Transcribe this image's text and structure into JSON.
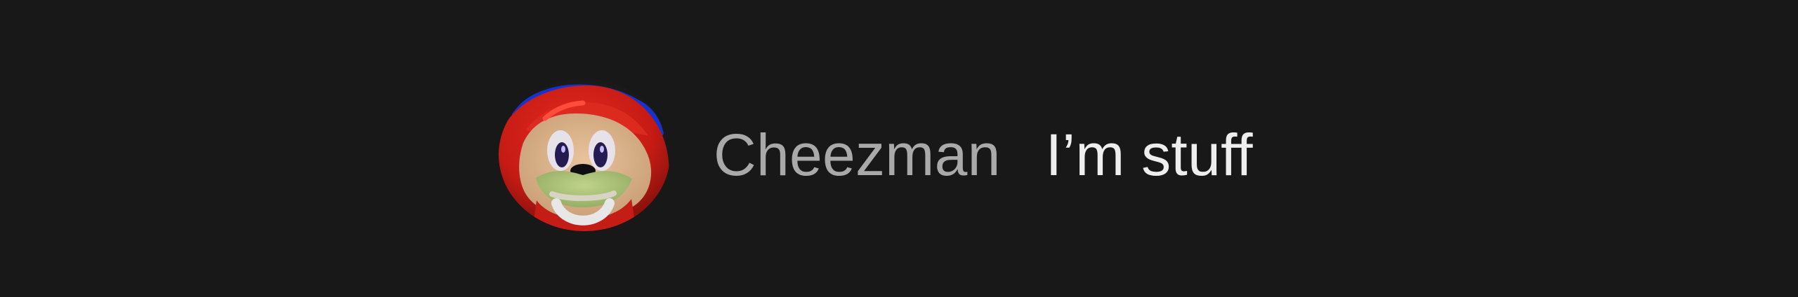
{
  "comment": {
    "author": "Cheezman",
    "message": "I’m stuff",
    "avatar": {
      "depicts": "red cartoon character avatar"
    }
  },
  "colors": {
    "background": "#181818",
    "author_text": "#a9a9a9",
    "message_text": "#eeeeee"
  }
}
